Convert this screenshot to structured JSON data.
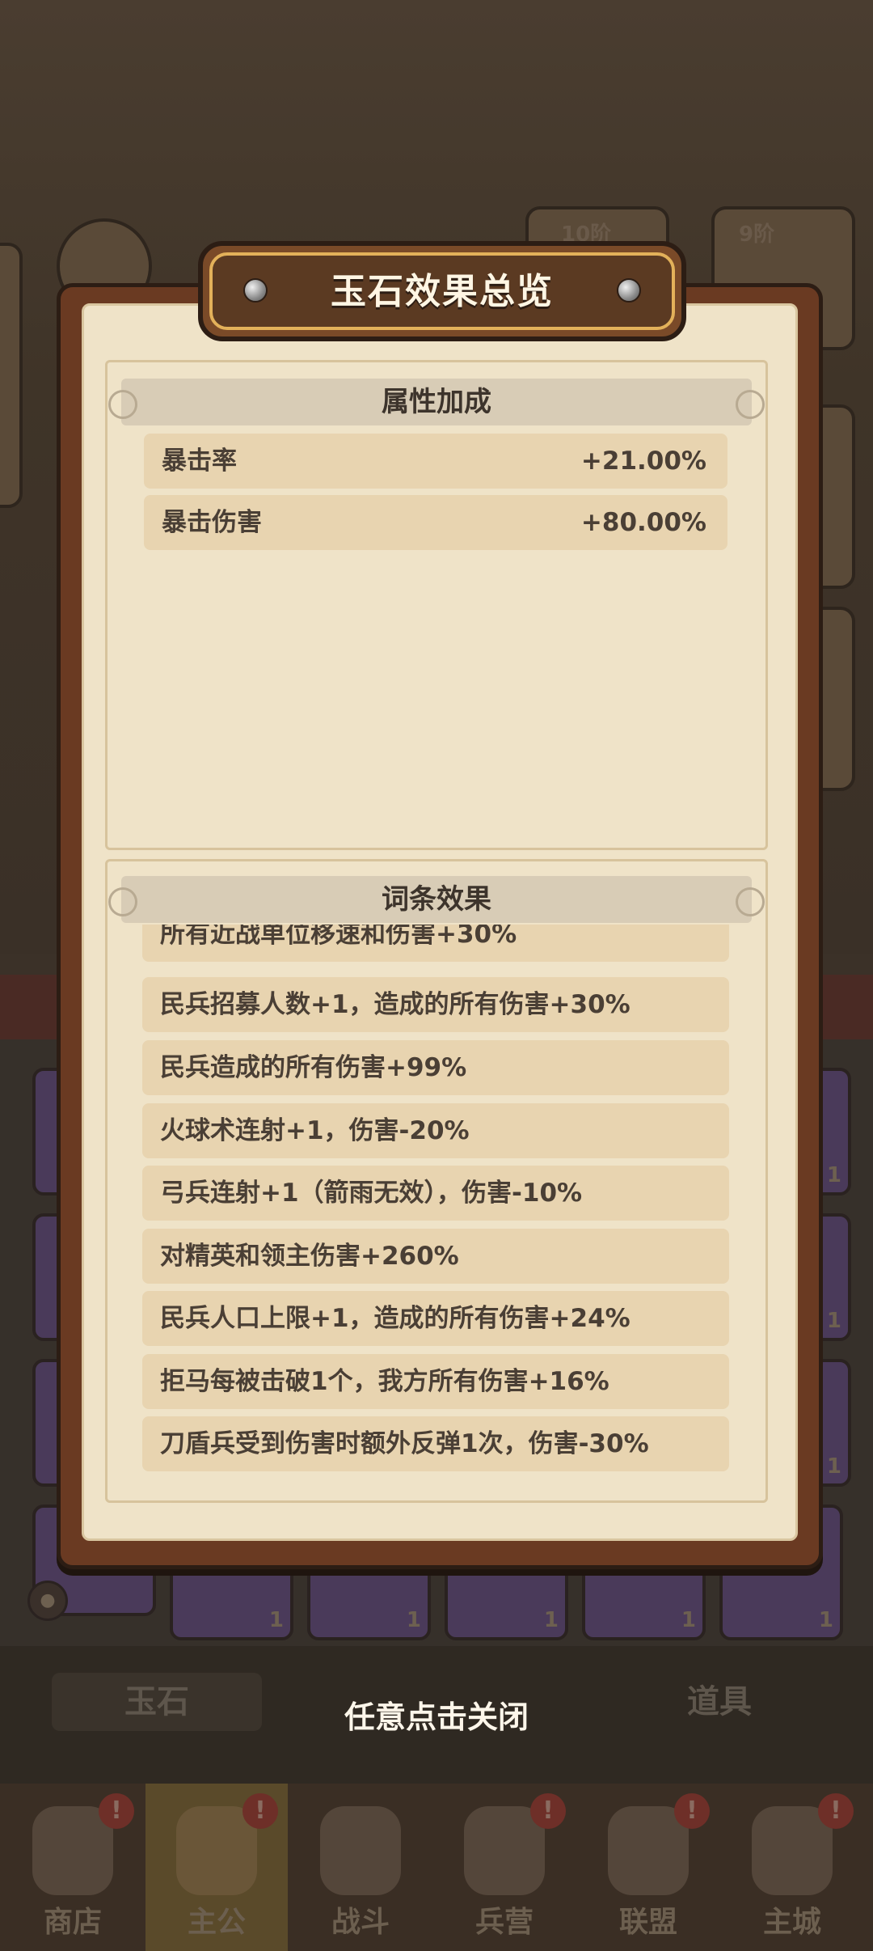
{
  "modal": {
    "title": "玉石效果总览",
    "attributes": {
      "header": "属性加成",
      "rows": [
        {
          "name": "暴击率",
          "value": "+21.00%"
        },
        {
          "name": "暴击伤害",
          "value": "+80.00%"
        }
      ]
    },
    "affixes": {
      "header": "词条效果",
      "items": [
        "所有近战单位移速和伤害+30%",
        "民兵招募人数+1，造成的所有伤害+30%",
        "民兵造成的所有伤害+99%",
        "火球术连射+1，伤害-20%",
        "弓兵连射+1（箭雨无效），伤害-10%",
        "对精英和领主伤害+260%",
        "民兵人口上限+1，造成的所有伤害+24%",
        "拒马每被击破1个，我方所有伤害+16%",
        "刀盾兵受到伤害时额外反弹1次，伤害-30%"
      ]
    }
  },
  "close_hint": "任意点击关闭",
  "background": {
    "tabs": [
      "玉石",
      "道具"
    ],
    "slot_count": "1",
    "top_badges": [
      "10阶",
      "9阶"
    ],
    "nav": [
      {
        "label": "商店",
        "badge": "!"
      },
      {
        "label": "主公",
        "badge": "!"
      },
      {
        "label": "战斗",
        "badge": ""
      },
      {
        "label": "兵营",
        "badge": "!"
      },
      {
        "label": "联盟",
        "badge": "!"
      },
      {
        "label": "主城",
        "badge": "!"
      }
    ]
  }
}
